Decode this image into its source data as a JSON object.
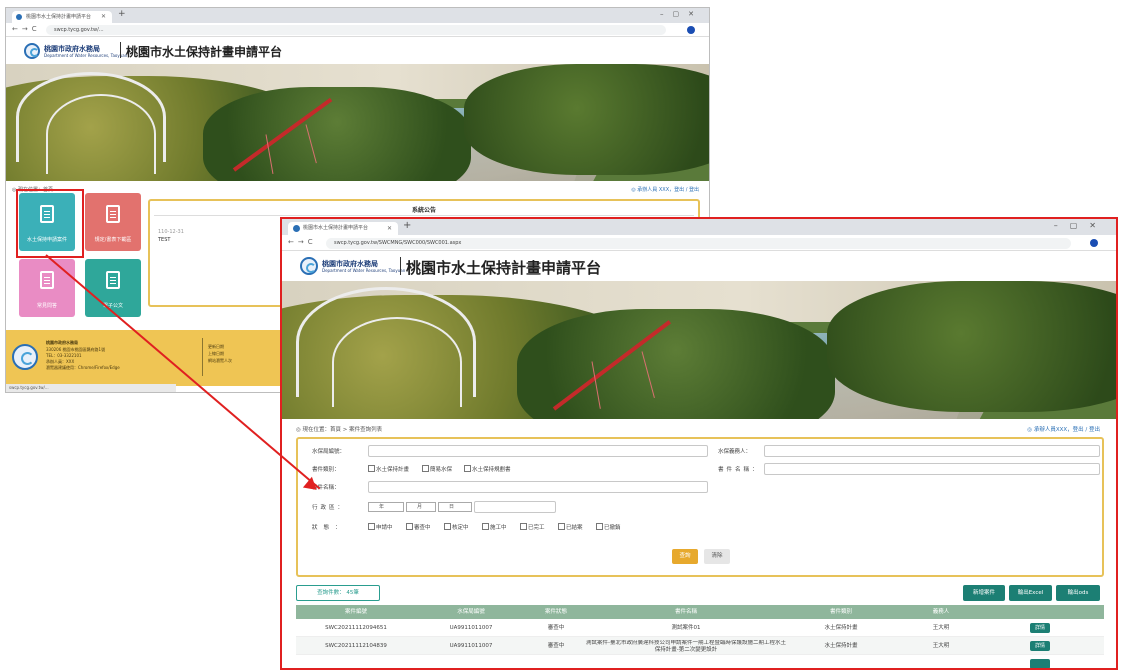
{
  "win1": {
    "tab_title": "桃園市水土保持計畫申請平台",
    "url": "swcp.tycg.gov.tw/...",
    "org_name": "桃園市政府水務局",
    "org_name_en": "Department of Water Resources, Taoyuan",
    "site_title": "桃園市水土保持計畫申請平台",
    "breadcrumb": "◎ 現在位置：首頁",
    "user": "◎ 承辦人員 XXX，登出 / 登出",
    "tiles": [
      {
        "label": "水土保持申請案件",
        "color": "#3bb0b8"
      },
      {
        "label": "規定/書表下載區",
        "color": "#e2726e"
      },
      {
        "label": "常見問答",
        "color": "#e98cc4"
      },
      {
        "label": "電子公文",
        "color": "#2fa79a"
      }
    ],
    "notice_title": "系統公告",
    "notice_date": "110-12-31",
    "notice_text": "TEST",
    "footer": {
      "name": "桃園市政府水務局",
      "lines": [
        "330206 桃園市桃園區縣府路1號",
        "TEL：03-3322101",
        "承辦人員：XXX",
        "瀏覽器建議使用：Chrome/Firefox/Edge"
      ],
      "right_lines": [
        "更新日期",
        "上線日期",
        "網站瀏覽人次"
      ]
    },
    "status_text": "swcp.tycg.gov.tw/..."
  },
  "win2": {
    "tab_title": "桃園市水土保持計畫申請平台",
    "url": "swcp.tycg.gov.tw/SWCMNG/SWC000/SWC001.aspx",
    "org_name": "桃園市政府水務局",
    "org_name_en": "Department of Water Resources, Taoyuan",
    "site_title": "桃園市水土保持計畫申請平台",
    "breadcrumb": "◎ 現在位置：首頁 > 案件查詢列表",
    "user": "◎ 承辦人員XXX，登出 / 登出",
    "form": {
      "labels": {
        "case_id": "水保局編號：",
        "applicant": "水保義務人：",
        "type": "書件類別：",
        "plan_name": "書件名稱：",
        "area": "行政區：",
        "status": "狀態："
      },
      "type_options": [
        "水土保持計畫",
        "簡易水保",
        "水土保持規劃書"
      ],
      "status_options": [
        "申請中",
        "審查中",
        "核定中",
        "施工中",
        "已完工",
        "已結案",
        "已撤銷"
      ],
      "date_selects": [
        "年",
        "月",
        "日"
      ],
      "search_label": "查詢",
      "clear_label": "清除"
    },
    "count_label": "查詢件數： 45筆",
    "toolbar": {
      "add_label": "新增案件",
      "excel_label": "輸出Excel",
      "ods_label": "輸出ods"
    },
    "columns": [
      "案件編號",
      "水保局編號",
      "案件狀態",
      "書件名稱",
      "書件類別",
      "義務人",
      ""
    ],
    "rows": [
      {
        "id": "SWC20211112094651",
        "swc": "UA9911011007",
        "status": "審查中",
        "name": "測試案件01",
        "type": "水土保持計畫",
        "owner": "王大明",
        "action": "詳情"
      },
      {
        "id": "SWC20211112104839",
        "swc": "UA9911011007",
        "status": "審查中",
        "name": "測試案件-臺北市政府廣達科技公司申請案件一期工程暨臨時保護設施二期工程水土保持計畫-第二次變更設計",
        "type": "水土保持計畫",
        "owner": "王大明",
        "action": "詳情"
      },
      {
        "id": "",
        "swc": "",
        "status": "",
        "name": "",
        "type": "",
        "owner": "",
        "action": ""
      }
    ]
  },
  "colors": {
    "accent": "#1c7f74",
    "highlight": "#e02020",
    "form_border": "#e7c259",
    "footer": "#efc554",
    "search_btn": "#e7a92d"
  }
}
